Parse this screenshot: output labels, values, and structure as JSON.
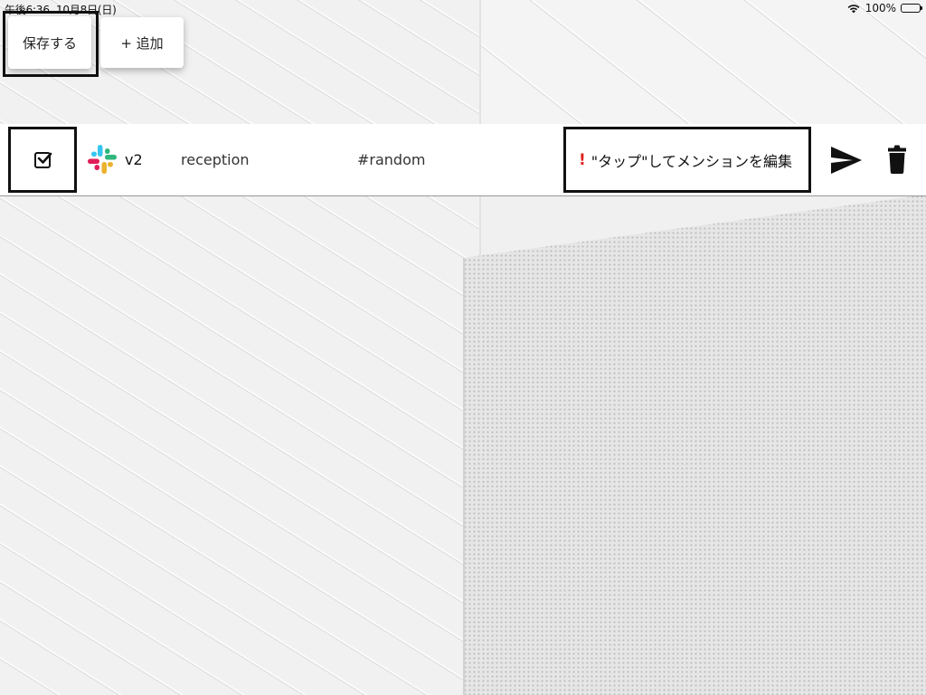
{
  "status_bar": {
    "time": "午後6:36",
    "date": "10月8日(日)",
    "wifi_icon": "wifi-icon",
    "battery": "100%",
    "battery_icon": "battery-full-icon"
  },
  "toolbar": {
    "save_label": "保存する",
    "add_label": "+ 追加"
  },
  "row": {
    "checked": true,
    "app_icon": "slack-logo-icon",
    "version": "v2",
    "bot_name": "reception",
    "channel": "#random",
    "mention_alert_icon": "exclamation-icon",
    "mention_label": "\"タップ\"してメンションを編集",
    "send_icon": "paper-plane-icon",
    "delete_icon": "trash-icon"
  },
  "colors": {
    "alert": "#e0201b",
    "row_background": "#ffffff",
    "highlight_border": "#111111"
  }
}
